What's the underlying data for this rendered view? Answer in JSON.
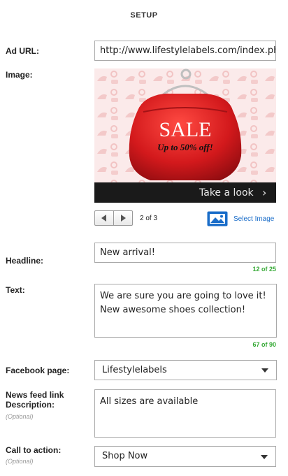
{
  "header": {
    "title": "SETUP"
  },
  "ad_url": {
    "label": "Ad URL:",
    "value": "http://www.lifestylelabels.com/index.php/w"
  },
  "image": {
    "label": "Image:",
    "sale_text": "SALE",
    "discount_text": "Up to 50% off!",
    "cta_banner": "Take a look",
    "cta_chevron": "›",
    "pager_text": "2 of 3",
    "select_label": "Select Image"
  },
  "headline": {
    "label": "Headline:",
    "value": "New arrival!",
    "counter": "12 of 25"
  },
  "text": {
    "label": "Text:",
    "value": "We are sure you are going to love it! New awesome shoes collection!",
    "counter": "67 of 90"
  },
  "facebook_page": {
    "label": "Facebook page:",
    "value": "Lifestylelabels"
  },
  "news_feed": {
    "label_line1": "News feed link",
    "label_line2": "Description:",
    "optional": "(Optional)",
    "value": "All sizes are available"
  },
  "call_to_action": {
    "label": "Call to action:",
    "optional": "(Optional)",
    "value": "Shop Now"
  },
  "colors": {
    "accent_blue": "#1a6dc9",
    "counter_green": "#35a935",
    "bag_red": "#d3191c",
    "pattern_pink": "#f6d8d8"
  },
  "icons": {
    "prev": "triangle-left-icon",
    "next": "triangle-right-icon",
    "select_image": "image-icon",
    "dropdown": "caret-down-icon"
  }
}
